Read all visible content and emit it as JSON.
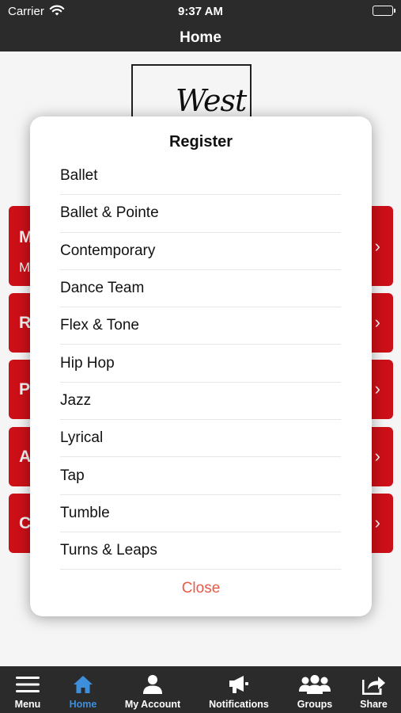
{
  "status_bar": {
    "carrier": "Carrier",
    "time": "9:37 AM"
  },
  "nav": {
    "title": "Home"
  },
  "logo": {
    "text": "West"
  },
  "tiles": [
    {
      "title": "M",
      "subtitle": "M"
    },
    {
      "title": "R",
      "subtitle": ""
    },
    {
      "title": "P",
      "subtitle": ""
    },
    {
      "title": "A",
      "subtitle": ""
    },
    {
      "title": "C",
      "subtitle": ""
    }
  ],
  "modal": {
    "title": "Register",
    "items": [
      "Ballet",
      "Ballet & Pointe",
      "Contemporary",
      "Dance Team",
      "Flex & Tone",
      "Hip Hop",
      "Jazz",
      "Lyrical",
      "Tap",
      "Tumble",
      "Turns & Leaps"
    ],
    "close_label": "Close"
  },
  "tab_bar": {
    "tabs": [
      {
        "label": "Menu",
        "icon": "hamburger-icon"
      },
      {
        "label": "Home",
        "icon": "house-icon",
        "active": true
      },
      {
        "label": "My Account",
        "icon": "person-icon"
      },
      {
        "label": "Notifications",
        "icon": "megaphone-icon"
      },
      {
        "label": "Groups",
        "icon": "group-icon"
      },
      {
        "label": "Share",
        "icon": "share-icon"
      }
    ]
  },
  "colors": {
    "header_bg": "#2b2b2b",
    "tile_red": "#d6101a",
    "close_text": "#e85a47",
    "active_tab": "#3d8fdc"
  }
}
